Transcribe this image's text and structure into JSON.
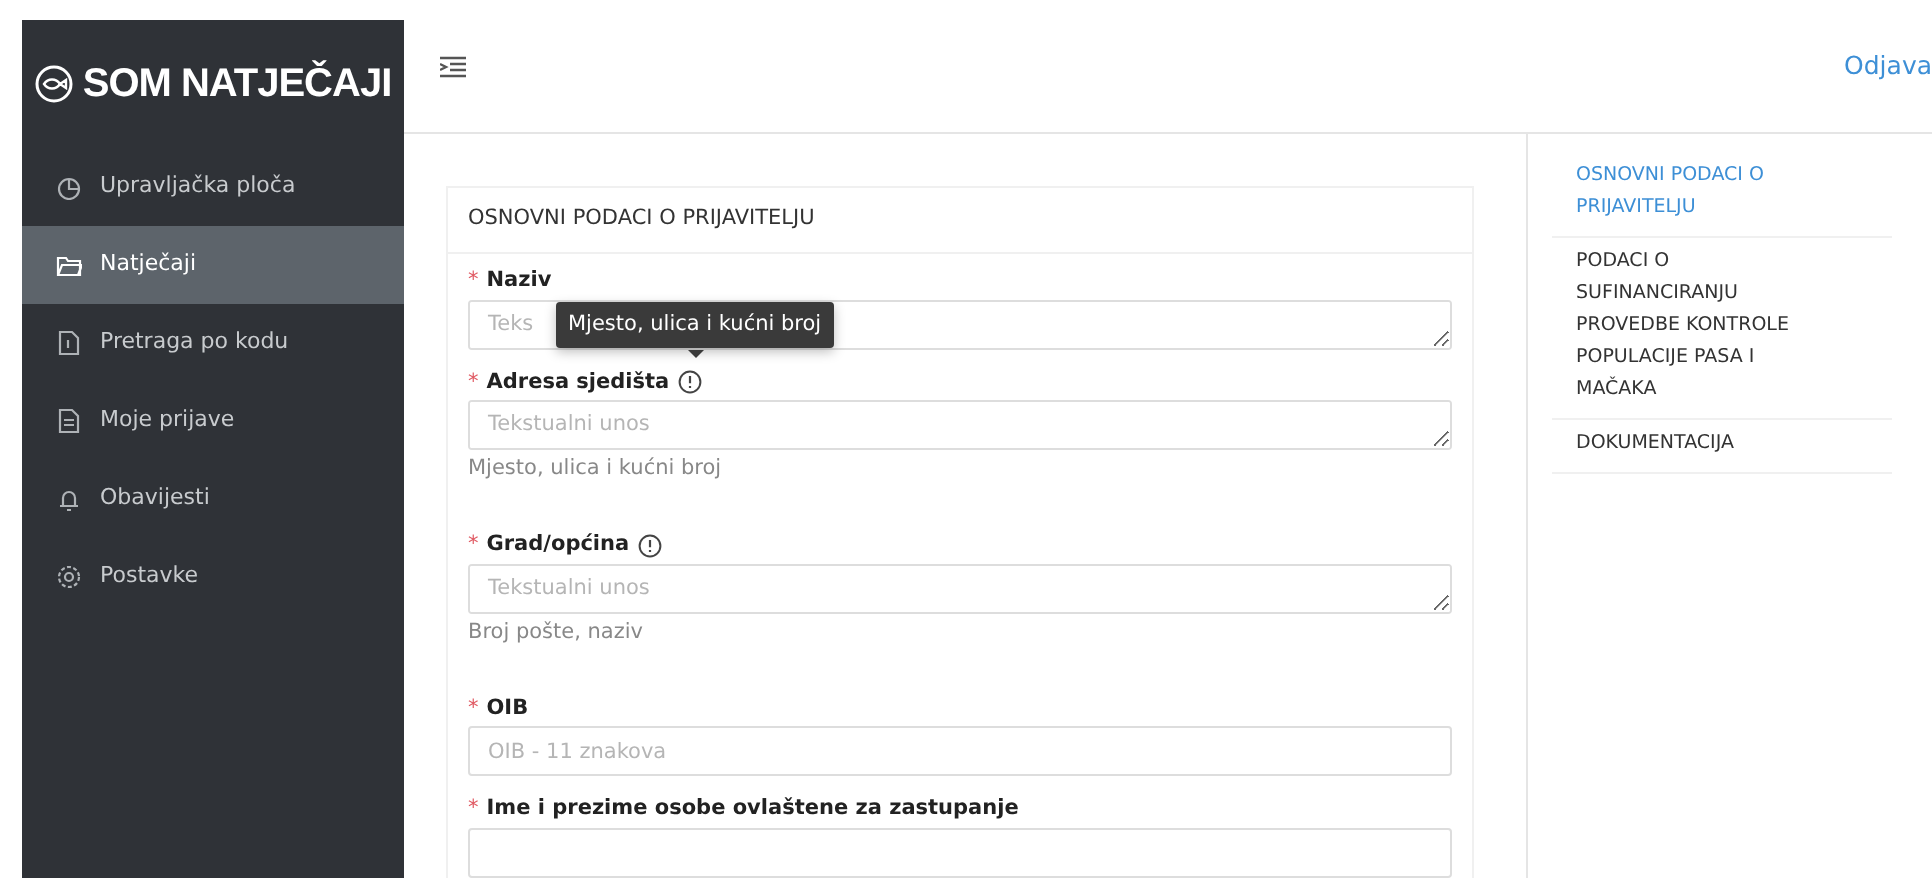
{
  "brand": {
    "title": "SOM NATJEČAJI"
  },
  "sidebar": {
    "items": [
      {
        "label": "Upravljačka ploča",
        "selected": false
      },
      {
        "label": "Natječaji",
        "selected": true
      },
      {
        "label": "Pretraga po kodu",
        "selected": false
      },
      {
        "label": "Moje prijave",
        "selected": false
      },
      {
        "label": "Obavijesti",
        "selected": false
      },
      {
        "label": "Postavke",
        "selected": false
      }
    ]
  },
  "header": {
    "logout": "Odjava"
  },
  "form": {
    "section_title": "OSNOVNI PODACI O PRIJAVITELJU",
    "fields": [
      {
        "mark": "*",
        "label": "Naziv",
        "kind": "textarea",
        "info": false,
        "placeholder": "Teks"
      },
      {
        "mark": "*",
        "label": "Adresa sjedišta",
        "kind": "textarea",
        "info": true,
        "tooltip": "Mjesto, ulica i kućni broj",
        "placeholder": "Tekstualni unos",
        "help": "Mjesto, ulica i kućni broj"
      },
      {
        "mark": "*",
        "label": "Grad/općina",
        "kind": "textarea",
        "info": true,
        "placeholder": "Tekstualni unos",
        "help": "Broj pošte, naziv"
      },
      {
        "mark": "*",
        "label": "OIB",
        "kind": "input",
        "info": false,
        "placeholder": "OIB - 11 znakova"
      },
      {
        "mark": "*",
        "label": "Ime i prezime osobe ovlaštene za zastupanje",
        "kind": "input",
        "info": false
      }
    ]
  },
  "section_nav": {
    "items": [
      {
        "label": "OSNOVNI PODACI O PRIJAVITELJU",
        "selected": true
      },
      {
        "label": "PODACI O SUFINANCIRANJU PROVEDBE KONTROLE POPULACIJE PASA I MAČAKA",
        "selected": false
      },
      {
        "label": "DOKUMENTACIJA",
        "selected": false
      }
    ]
  }
}
